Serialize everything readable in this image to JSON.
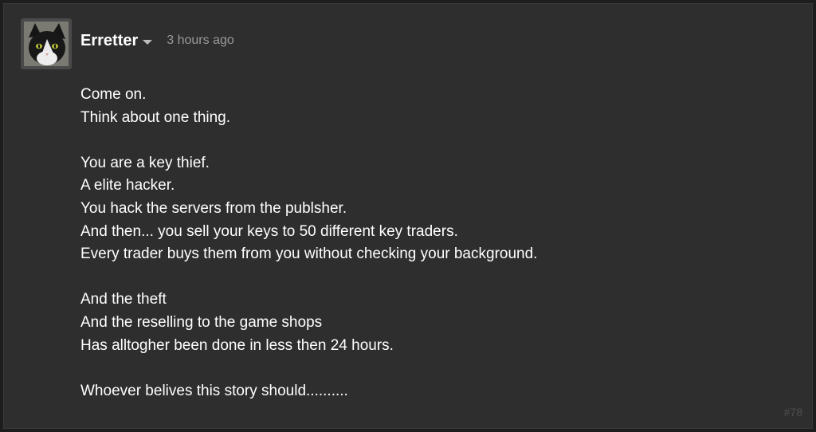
{
  "comment": {
    "author": "Erretter",
    "timestamp": "3 hours ago",
    "avatar": "cat-avatar",
    "lines": [
      "Come on.",
      "Think about one thing.",
      "",
      "You are a key thief.",
      "A elite hacker.",
      "You hack the servers from the publsher.",
      "And then... you sell your keys to 50 different key traders.",
      "Every trader buys them from you without checking your background.",
      "",
      "And the theft",
      "And the reselling to the game shops",
      "Has alltogher been done in less then 24 hours.",
      "",
      "Whoever belives this story should.........."
    ],
    "post_number": "#78"
  },
  "colors": {
    "background": "#1d1d1d",
    "card": "#2e2e2e",
    "text": "#ffffff",
    "muted": "#9a9a9a"
  }
}
